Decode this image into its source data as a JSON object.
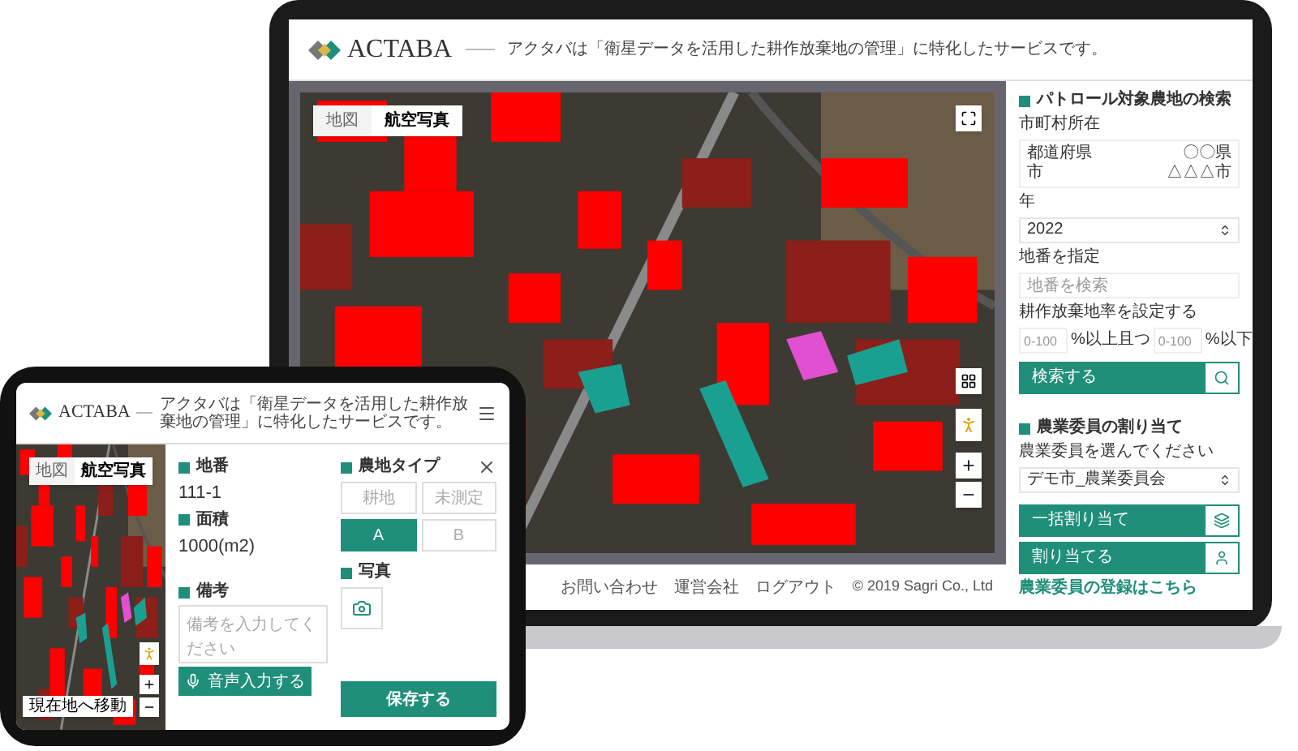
{
  "laptop": {
    "header": {
      "logo": "ACTABA",
      "tagline": "アクタバは「衛星データを活用した耕作放棄地の管理」に特化したサービスです。"
    },
    "map_tabs": [
      {
        "label": "地図",
        "selected": false
      },
      {
        "label": "航空写真",
        "selected": true
      }
    ],
    "footer_links": [
      "お問い合わせ",
      "運営会社",
      "ログアウト"
    ],
    "copyright": "© 2019 Sagri Co., Ltd",
    "search_panel": {
      "title": "パトロール対象農地の検索",
      "location_label": "市町村所在",
      "location_rows": [
        {
          "label": "都道府県",
          "value": "〇〇県"
        },
        {
          "label": "市",
          "value": "△△△市"
        }
      ],
      "year_label": "年",
      "year_value": "2022",
      "lot_label": "地番を指定",
      "lot_placeholder": "地番を検索",
      "rate_label": "耕作放棄地率を設定する",
      "rate_min_placeholder": "0-100",
      "rate_min_suffix": "%以上且つ",
      "rate_max_placeholder": "0-100",
      "rate_max_suffix": "%以下",
      "search_button": "検索する"
    },
    "assign_panel": {
      "title": "農業委員の割り当て",
      "select_label": "農業委員を選んでください",
      "select_value": "デモ市_農業委員会",
      "bulk_button": "一括割り当て",
      "assign_button": "割り当てる",
      "register_link": "農業委員の登録はこちら"
    }
  },
  "tablet": {
    "header": {
      "logo": "ACTABA",
      "tagline": "アクタバは「衛星データを活用した耕作放棄地の管理」に特化したサービスです。"
    },
    "map_tabs": [
      {
        "label": "地図",
        "selected": false
      },
      {
        "label": "航空写真",
        "selected": true
      }
    ],
    "locate_button": "現在地へ移動",
    "plot_number": {
      "label": "地番",
      "value": "111-1"
    },
    "area": {
      "label": "面積",
      "value": "1000(m2)"
    },
    "note": {
      "label": "備考",
      "placeholder": "備考を入力してください"
    },
    "voice_button": "音声入力する",
    "farm_type": {
      "label": "農地タイプ",
      "options": [
        {
          "label": "耕地",
          "selected": false
        },
        {
          "label": "未測定",
          "selected": false
        },
        {
          "label": "A",
          "selected": true
        },
        {
          "label": "B",
          "selected": false
        }
      ]
    },
    "photo_label": "写真",
    "save_button": "保存する"
  }
}
